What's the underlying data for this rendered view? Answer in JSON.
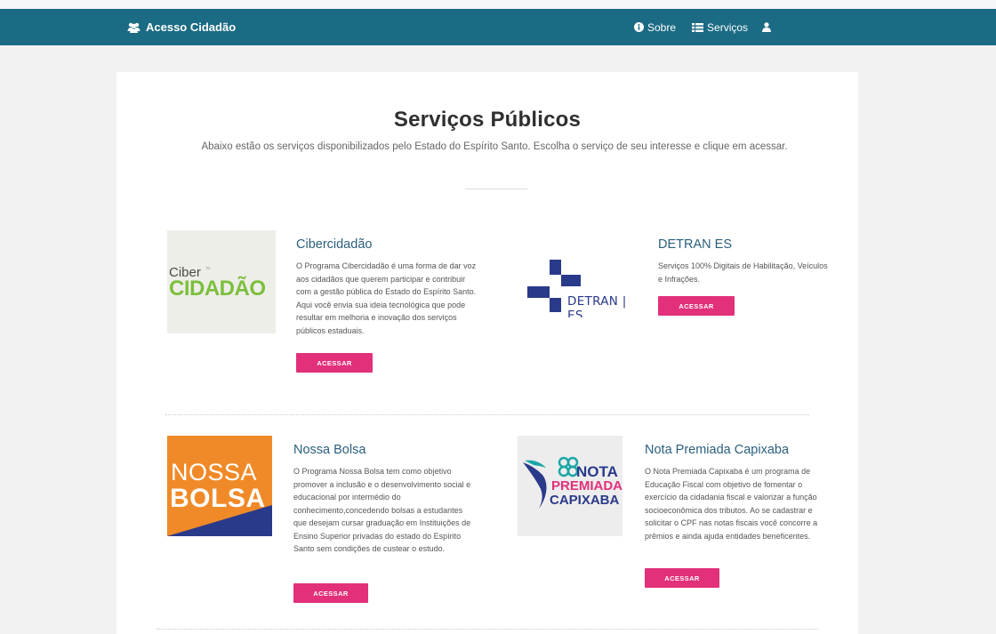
{
  "navbar": {
    "brand": "Acesso Cidadão",
    "links": {
      "about": "Sobre",
      "services": "Serviços"
    }
  },
  "header": {
    "title": "Serviços Públicos",
    "subtitle": "Abaixo estão os serviços disponibilizados pelo Estado do Espírito Santo. Escolha o serviço de seu interesse e clique em acessar."
  },
  "services": [
    {
      "title": "Cibercidadão",
      "description": "O Programa Cibercidadão é uma forma de dar voz aos cidadãos que querem participar e contribuir com a gestão pública do Estado do Espírito Santo. Aqui você envia sua ideia tecnológica que pode resultar em melhoria e inovação dos serviços públicos estaduais.",
      "button": "ACESSAR",
      "logo": {
        "line1": "Ciber",
        "small": "tu",
        "line2": "CIDADÃO"
      }
    },
    {
      "title": "DETRAN ES",
      "description": "Serviços 100% Digitais de Habilitação, Veículos e Infrações.",
      "button": "ACESSAR",
      "logo": {
        "text": "DETRAN | ES"
      }
    },
    {
      "title": "Nossa Bolsa",
      "description": "O Programa Nossa Bolsa tem como objetivo promover a inclusão e o desenvolvimento social e educacional por intermédio do conhecimento,concedendo bolsas a estudantes que desejam cursar graduação em Instituições de Ensino Superior privadas do estado do Espírito Santo sem condições de custear o estudo.",
      "button": "ACESSAR",
      "logo": {
        "line1": "NOSSA",
        "line2": "BOLSA"
      }
    },
    {
      "title": "Nota Premiada Capixaba",
      "description": "O Nota Premiada Capixaba é um programa de Educação Fiscal com objetivo de fomentar o exercício da cidadania fiscal e valorizar a função socioeconômica dos tributos. Ao se cadastrar e solicitar o CPF nas notas fiscais você concorre a prêmios e ainda ajuda entidades beneficentes.",
      "button": "ACESSAR",
      "logo": {
        "line1": "NOTA",
        "line2": "PREMIADA",
        "line3": "CAPIXABA"
      }
    }
  ],
  "colors": {
    "navbar": "#1b6b84",
    "accent_button": "#e2307a",
    "service_title": "#2a5f7d",
    "page_background": "#f2f2f2"
  },
  "icons": {
    "brand": "users-icon",
    "about": "info-circle-icon",
    "services": "th-list-icon",
    "user": "user-icon"
  }
}
